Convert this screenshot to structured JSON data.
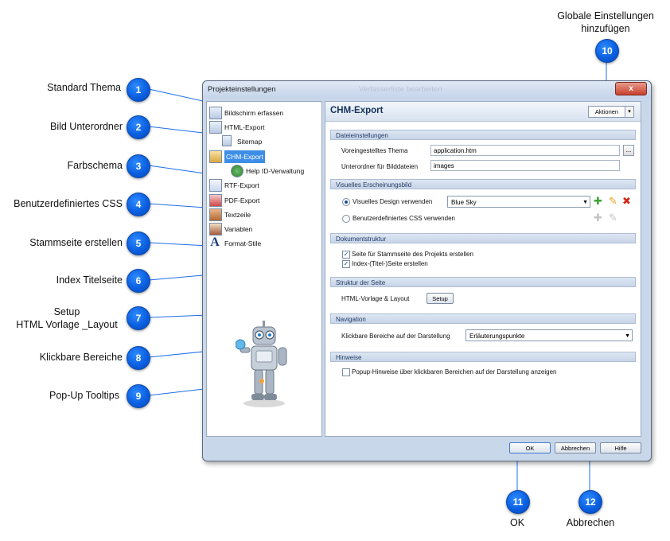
{
  "callouts": [
    {
      "num": "1",
      "label": "Standard Thema"
    },
    {
      "num": "2",
      "label": "Bild Unterordner"
    },
    {
      "num": "3",
      "label": "Farbschema"
    },
    {
      "num": "4",
      "label": "Benutzerdefiniertes CSS"
    },
    {
      "num": "5",
      "label": "Stammseite erstellen"
    },
    {
      "num": "6",
      "label": "Index Titelseite"
    },
    {
      "num": "7",
      "label_line1": "Setup",
      "label_line2": "HTML Vorlage _Layout"
    },
    {
      "num": "8",
      "label": "Klickbare Bereiche"
    },
    {
      "num": "9",
      "label": "Pop-Up Tooltips"
    },
    {
      "num": "10",
      "label_line1": "Globale Einstellungen",
      "label_line2": "hinzufügen"
    },
    {
      "num": "11",
      "label": "OK"
    },
    {
      "num": "12",
      "label": "Abbrechen"
    }
  ],
  "dialog": {
    "title": "Projekteinstellungen",
    "ghost_title": "Verfasserliste bearbeiten",
    "close": "x",
    "nav": [
      {
        "label": "Bildschirm erfassen"
      },
      {
        "label": "HTML-Export"
      },
      {
        "label": "Sitemap"
      },
      {
        "label": "CHM-Export"
      },
      {
        "label": "Help ID-Verwaltung"
      },
      {
        "label": "RTF-Export"
      },
      {
        "label": "PDF-Export"
      },
      {
        "label": "Textzeile"
      },
      {
        "label": "Variablen"
      },
      {
        "label": "Format-Stile"
      }
    ],
    "content": {
      "title": "CHM-Export",
      "aktionen": "Aktionen",
      "aktionen_arrow": "▾",
      "sec_dateien": "Dateieinstellungen",
      "label_thema": "Voreingestelltes Thema",
      "value_thema": "application.htm",
      "browse": "...",
      "label_unterordner": "Unterordner für Bilddateien",
      "value_unterordner": "images",
      "sec_visuell": "Visuelles Erscheinungsbild",
      "radio_design": "Visuelles Design verwenden",
      "design_value": "Blue Sky",
      "radio_css": "Benutzerdefiniertes CSS verwenden",
      "sec_struktur": "Dokumentstruktur",
      "check_stamm": "Seite für Stammseite des Projekts erstellen",
      "check_index": "Index-(Titel-)Seite erstellen",
      "sec_seite": "Struktur der Seite",
      "label_vorlage": "HTML-Vorlage & Layout",
      "setup": "Setup",
      "sec_navigation": "Navigation",
      "label_klick": "Klickbare Bereiche auf der Darstellung",
      "klick_value": "Erläuterungspunkte",
      "sec_hinweise": "Hinweise",
      "check_popup": "Popup-Hinweise über klickbaren Bereichen auf der Darstellung anzeigen"
    },
    "buttons": {
      "ok": "OK",
      "cancel": "Abbrechen",
      "help": "Hilfe"
    }
  }
}
